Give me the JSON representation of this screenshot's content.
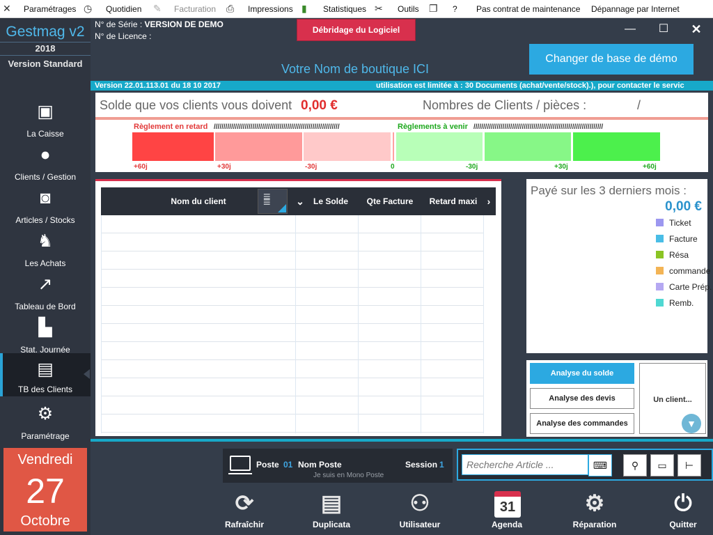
{
  "menubar": {
    "items": [
      {
        "label": "Paramétrages",
        "icon": "tools-icon",
        "enabled": true
      },
      {
        "label": "Quotidien",
        "icon": "clock-icon",
        "enabled": true
      },
      {
        "label": "Facturation",
        "icon": "document-icon",
        "enabled": false
      },
      {
        "label": "Impressions",
        "icon": "printer-icon",
        "enabled": true
      },
      {
        "label": "Statistiques",
        "icon": "stats-icon",
        "enabled": true
      },
      {
        "label": "Outils",
        "icon": "wrench-icon",
        "enabled": true
      },
      {
        "label": "?",
        "icon": "help-book-icon",
        "enabled": true
      },
      {
        "label": "Pas contrat de maintenance",
        "enabled": true
      },
      {
        "label": "Dépannage par Internet",
        "enabled": true
      }
    ]
  },
  "app": {
    "title": "Gestmag v2",
    "year": "2018",
    "edition": "Version Standard"
  },
  "header": {
    "serial_label": "N° de Série :",
    "serial_value": "VERSION DE DEMO",
    "licence_label": "N° de Licence :",
    "debridage_label": "Débridage du Logiciel",
    "change_db_label": "Changer de base de démo",
    "shop_name": "Votre Nom de boutique ICI",
    "version_text": "Version 22.01.113.01 du 18 10 2017",
    "ticker_text": "utilisation est limitée à : 30 Documents (achat/vente/stock).), pour contacter le servic"
  },
  "sidebar": {
    "items": [
      {
        "label": "La Caisse",
        "icon": "cash-register-icon",
        "active": false
      },
      {
        "label": "Clients / Gestion",
        "icon": "user-icon",
        "active": false
      },
      {
        "label": "Articles / Stocks",
        "icon": "shopping-bag-icon",
        "active": false
      },
      {
        "label": "Les Achats",
        "icon": "delivery-cart-icon",
        "active": false
      },
      {
        "label": "Tableau de Bord",
        "icon": "trend-chart-icon",
        "active": false
      },
      {
        "label": "Stat. Journée",
        "icon": "bar-chart-icon",
        "active": false
      },
      {
        "label": "TB des Clients",
        "icon": "client-book-icon",
        "active": true
      },
      {
        "label": "Paramétrage",
        "icon": "gears-icon",
        "active": false
      }
    ]
  },
  "date": {
    "day_name": "Vendredi",
    "day_number": "27",
    "month_name": "Octobre"
  },
  "solde": {
    "label": "Solde que vos clients vous doivent",
    "value": "0,00 €",
    "clients_label": "Nombres de Clients / pièces :",
    "clients_sep": "/",
    "retard_label": "Règlement en retard",
    "retard_slashes": "/////////////////////////////////////////////////////////////////",
    "avenir_label": "Règlements à venir",
    "avenir_slashes": "///////////////////////////////////////////////////////////////////",
    "ticks": [
      "+60j",
      "+30j",
      "-30j",
      "0",
      "-30j",
      "+30j",
      "+60j"
    ],
    "colors": {
      "retard_60": "#ff4444",
      "retard_30": "#ff9a9a",
      "retard_0": "#ffc9c9",
      "avenir_0": "#b8ffb8",
      "avenir_30": "#87f787",
      "avenir_60": "#4cf04c"
    }
  },
  "client_table": {
    "columns": [
      "Nom du client",
      "Le Solde",
      "Qte Facture",
      "Retard maxi"
    ],
    "rows": []
  },
  "paye": {
    "label": "Payé sur les 3 derniers mois :",
    "value": "0,00 €",
    "legend": [
      {
        "label": "Ticket",
        "color": "#9c97f0"
      },
      {
        "label": "Facture",
        "color": "#49bde6"
      },
      {
        "label": "Résa",
        "color": "#8bc424"
      },
      {
        "label": "commande",
        "color": "#f3b455"
      },
      {
        "label": "Carte Prép.",
        "color": "#b5a8f2"
      },
      {
        "label": "Remb.",
        "color": "#4fd8d2"
      }
    ]
  },
  "analyse": {
    "buttons": [
      "Analyse du solde",
      "Analyse des devis",
      "Analyse des commandes"
    ],
    "un_client": "Un client..."
  },
  "poste": {
    "poste_label": "Poste",
    "poste_num": "01",
    "poste_name": "Nom Poste",
    "session_label": "Session",
    "session_num": "1",
    "mode": "Je suis en Mono Poste"
  },
  "search": {
    "placeholder": "Recherche Article ..."
  },
  "toolbar": {
    "items": [
      {
        "label": "Rafraîchir",
        "icon": "refresh-icon"
      },
      {
        "label": "Duplicata",
        "icon": "duplicate-icon"
      },
      {
        "label": "Utilisateur",
        "icon": "users-key-icon"
      },
      {
        "label": "Agenda",
        "icon": "calendar-icon",
        "badge": "31"
      },
      {
        "label": "Réparation",
        "icon": "repair-gears-icon"
      },
      {
        "label": "Quitter",
        "icon": "power-icon"
      }
    ]
  }
}
